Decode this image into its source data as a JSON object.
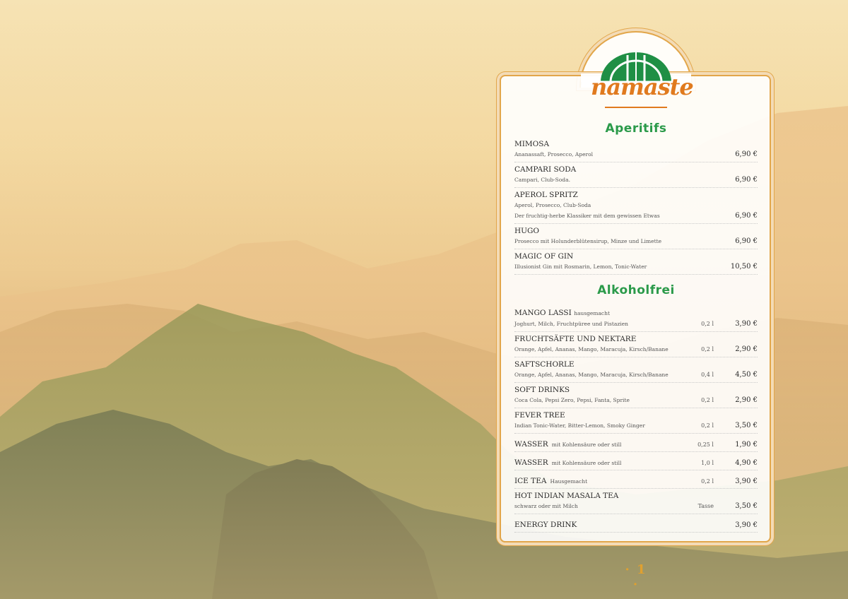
{
  "brand": {
    "logo_text": "namaste"
  },
  "page_number": "· 1 ·",
  "sections": [
    {
      "title": "Aperitifs",
      "items": [
        {
          "name": "MIMOSA",
          "note": "",
          "lines": [
            {
              "desc": "Ananassaft, Prosecco, Aperol",
              "size": "",
              "price": "6,90 €"
            }
          ]
        },
        {
          "name": "CAMPARI SODA",
          "note": "",
          "lines": [
            {
              "desc": "Campari, Club-Soda.",
              "size": "",
              "price": "6,90 €"
            }
          ]
        },
        {
          "name": "APEROL SPRITZ",
          "note": "",
          "lines": [
            {
              "desc": "Aperol, Prosecco, Club-Soda",
              "size": "",
              "price": ""
            },
            {
              "desc": "Der fruchtig-herbe Klassiker mit dem gewissen Etwas",
              "size": "",
              "price": "6,90 €"
            }
          ]
        },
        {
          "name": "HUGO",
          "note": "",
          "lines": [
            {
              "desc": "Prosecco mit Holunderblütensirup, Minze und Limette",
              "size": "",
              "price": "6,90 €"
            }
          ]
        },
        {
          "name": "MAGIC OF GIN",
          "note": "",
          "lines": [
            {
              "desc": "Illusionist Gin mit Rosmarin, Lemon, Tonic-Water",
              "size": "",
              "price": "10,50 €"
            }
          ]
        }
      ]
    },
    {
      "title": "Alkoholfrei",
      "items": [
        {
          "name": "MANGO LASSI",
          "note": "hausgemacht",
          "lines": [
            {
              "desc": "Joghurt, Milch, Fruchtpüree und Pistazien",
              "size": "0,2 l",
              "price": "3,90 €"
            }
          ]
        },
        {
          "name": "FRUCHTSÄFTE UND NEKTARE",
          "note": "",
          "lines": [
            {
              "desc": "Orange, Apfel, Ananas, Mango, Maracuja, Kirsch/Banane",
              "size": "0,2 l",
              "price": "2,90 €"
            }
          ]
        },
        {
          "name": "SAFTSCHORLE",
          "note": "",
          "lines": [
            {
              "desc": "Orange, Apfel, Ananas, Mango, Maracuja, Kirsch/Banane",
              "size": "0,4 l",
              "price": "4,50 €"
            }
          ]
        },
        {
          "name": "SOFT DRINKS",
          "note": "",
          "lines": [
            {
              "desc": "Coca Cola, Pepsi Zero, Pepsi, Fanta, Sprite",
              "size": "0,2 l",
              "price": "2,90 €"
            }
          ]
        },
        {
          "name": "FEVER TREE",
          "note": "",
          "lines": [
            {
              "desc": "Indian Tonic-Water, Bitter-Lemon, Smoky Ginger",
              "size": "0,2 l",
              "price": "3,50 €"
            }
          ]
        },
        {
          "name": "WASSER",
          "note": "mit Kohlensäure oder still",
          "inline": {
            "size": "0,25 l",
            "price": "1,90 €"
          }
        },
        {
          "name": "WASSER",
          "note": "mit Kohlensäure oder still",
          "inline": {
            "size": "1,0 l",
            "price": "4,90 €"
          }
        },
        {
          "name": "ICE TEA",
          "note": "Hausgemacht",
          "inline": {
            "size": "0,2 l",
            "price": "3,90 €"
          }
        },
        {
          "name": "HOT INDIAN MASALA TEA",
          "note": "",
          "lines": [
            {
              "desc": "schwarz oder mit Milch",
              "size": "Tasse",
              "price": "3,50 €"
            }
          ]
        },
        {
          "name": "ENERGY DRINK",
          "note": "",
          "inline": {
            "size": "",
            "price": "3,90 €"
          }
        }
      ]
    }
  ],
  "colors": {
    "accent_green": "#2b9a4a",
    "accent_orange": "#e07a1e",
    "frame_gold": "#e2a64a"
  }
}
